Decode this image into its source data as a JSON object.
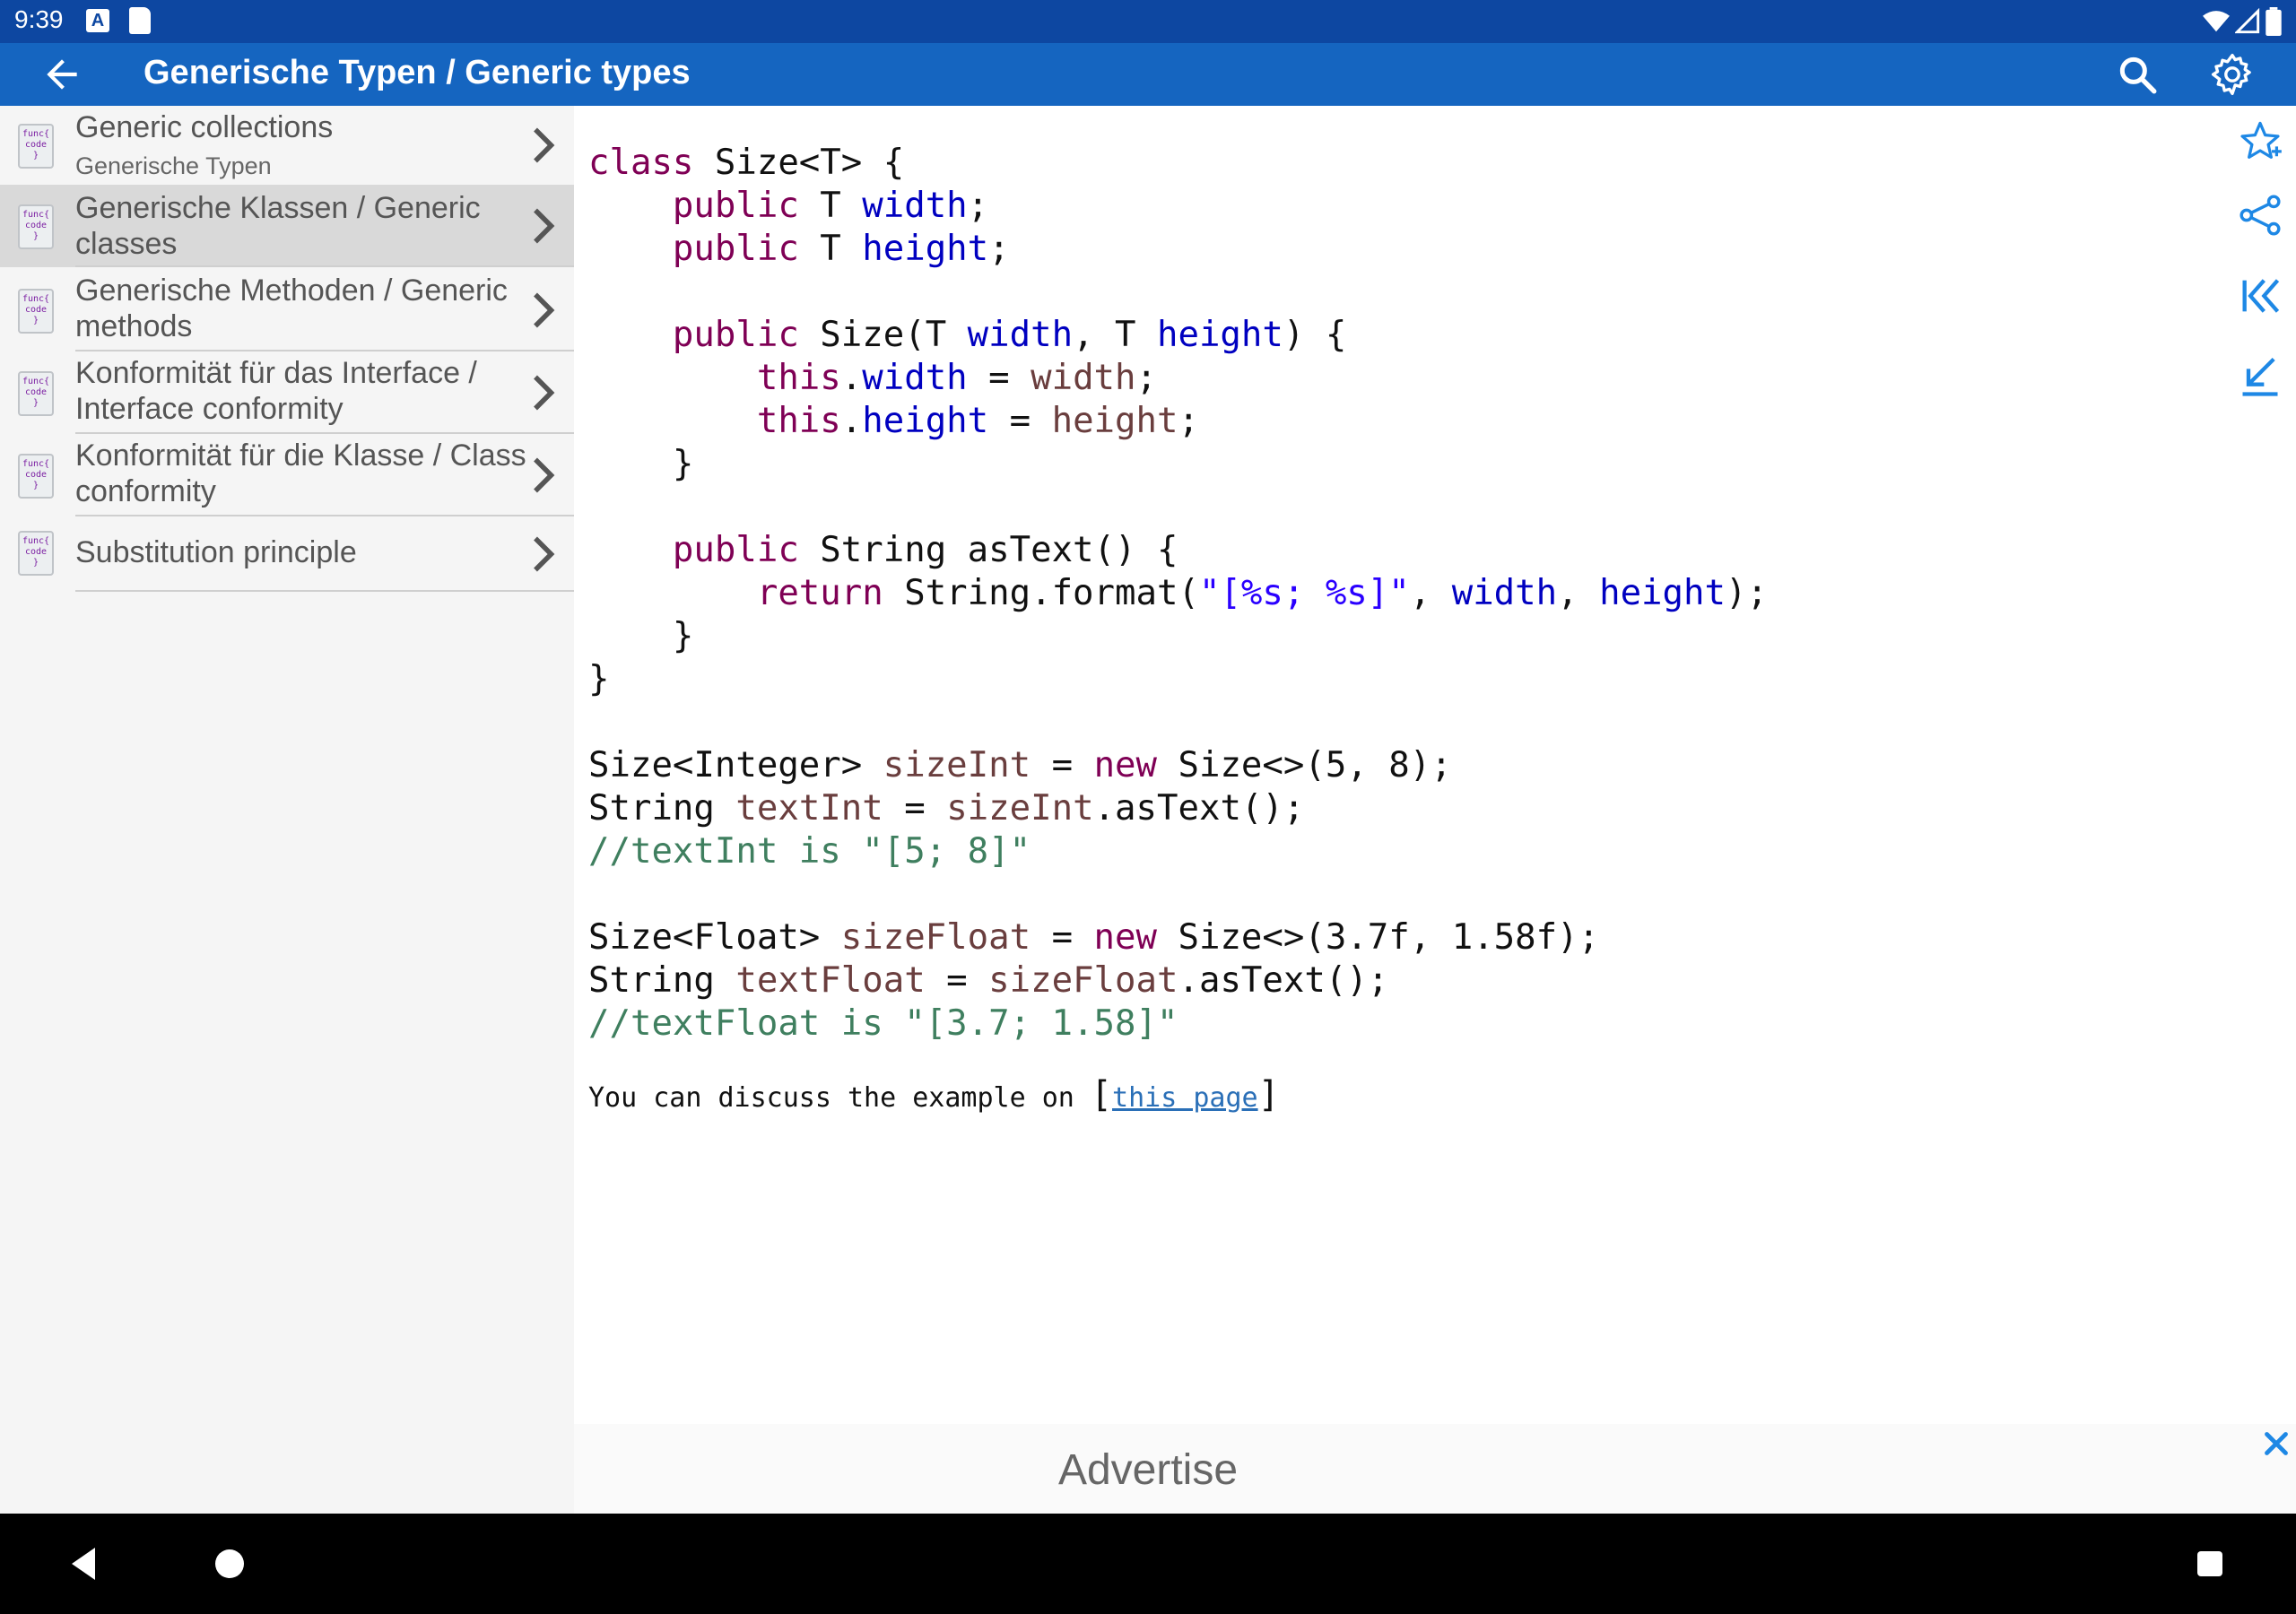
{
  "status": {
    "time": "9:39",
    "a_icon": "A"
  },
  "appbar": {
    "title": "Generische Typen / Generic types"
  },
  "sidebar": {
    "items": [
      {
        "title": "Generic collections",
        "subtitle": "Generische Typen",
        "selected": false
      },
      {
        "title": "Generische Klassen / Generic classes",
        "selected": true
      },
      {
        "title": "Generische Methoden / Generic methods",
        "selected": false
      },
      {
        "title": "Konformität für das Interface / Interface conformity",
        "selected": false
      },
      {
        "title": "Konformität für die Klasse / Class conformity",
        "selected": false
      },
      {
        "title": "Substitution principle",
        "selected": false
      }
    ],
    "icon_text": "func{ code }"
  },
  "code": {
    "lines": [
      "class Size<T> {",
      "    public T width;",
      "    public T height;",
      "",
      "    public Size(T width, T height) {",
      "        this.width = width;",
      "        this.height = height;",
      "    }",
      "",
      "    public String asText() {",
      "        return String.format(\"[%s; %s]\", width, height);",
      "    }",
      "}",
      "",
      "Size<Integer> sizeInt = new Size<>(5, 8);",
      "String textInt = sizeInt.asText();",
      "//textInt is \"[5; 8]\"",
      "",
      "Size<Float> sizeFloat = new Size<>(3.7f, 1.58f);",
      "String textFloat = sizeFloat.asText();",
      "//textFloat is \"[3.7; 1.58]\""
    ]
  },
  "discuss": {
    "prefix": "You can discuss the example on ",
    "link": "this page"
  },
  "ad": {
    "label": "Advertise"
  },
  "colors": {
    "statusbar": "#0d47a1",
    "appbar": "#1565c0",
    "selected": "#d9d9d9",
    "keyword": "#7f0055",
    "field": "#0000c0",
    "comment": "#3f7f5f"
  },
  "icons": [
    "back-arrow-icon",
    "search-icon",
    "gear-icon",
    "star-plus-icon",
    "share-icon",
    "skip-first-icon",
    "collapse-icon",
    "close-icon",
    "chevron-right-icon"
  ]
}
